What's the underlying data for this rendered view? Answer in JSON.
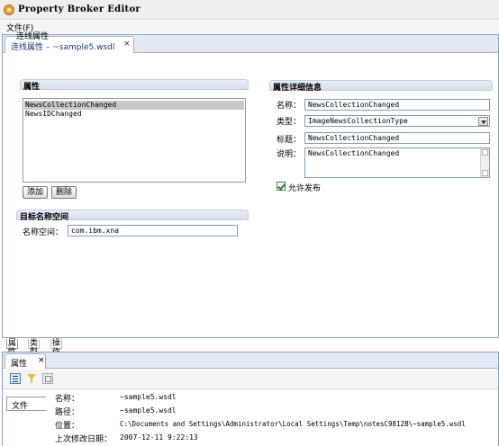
{
  "window": {
    "title": "Property Broker Editor"
  },
  "menu": {
    "file": "文件(F)"
  },
  "editor_tab": {
    "label": "连线属性 – ~sample5.wsdl",
    "close": "×"
  },
  "form": {
    "title": "连线属性",
    "properties_section": "属性",
    "properties": [
      "NewsCollectionChanged",
      "NewsIDChanged"
    ],
    "selected_property": "NewsCollectionChanged",
    "add_button": "添加",
    "delete_button": "删除",
    "namespace_section": "目标名称空间",
    "namespace_label": "名称空间：",
    "namespace_value": "com.ibm.xna",
    "details_section": "属性详细信息",
    "name_label": "名称：",
    "name_value": "NewsCollectionChanged",
    "type_label": "类型：",
    "type_value": "ImageNewsCollectionType",
    "caption_label": "标题：",
    "caption_value": "NewsCollectionChanged",
    "desc_label": "说明：",
    "desc_value": "NewsCollectionChanged",
    "publish_label": "允许发布",
    "publish_checked": true
  },
  "bottom_tabs": [
    "属性",
    "类型",
    "操作"
  ],
  "properties_view": {
    "tab_label": "属性",
    "tab_close": "×",
    "side_tab": "文件",
    "rows": [
      {
        "label": "名称：",
        "value": "~sample5.wsdl"
      },
      {
        "label": "路径：",
        "value": "~sample5.wsdl"
      },
      {
        "label": "位置：",
        "value": "C:\\Documents and Settings\\Administrator\\Local Settings\\Temp\\notesC9812B\\~sample5.wsdl"
      },
      {
        "label": "上次修改日期：",
        "value": "2007-12-11 9:22:13"
      }
    ]
  },
  "colors": {
    "tab_bar": "#e3eaf3",
    "selection": "#c8c8c8",
    "border": "#7f9db9"
  }
}
